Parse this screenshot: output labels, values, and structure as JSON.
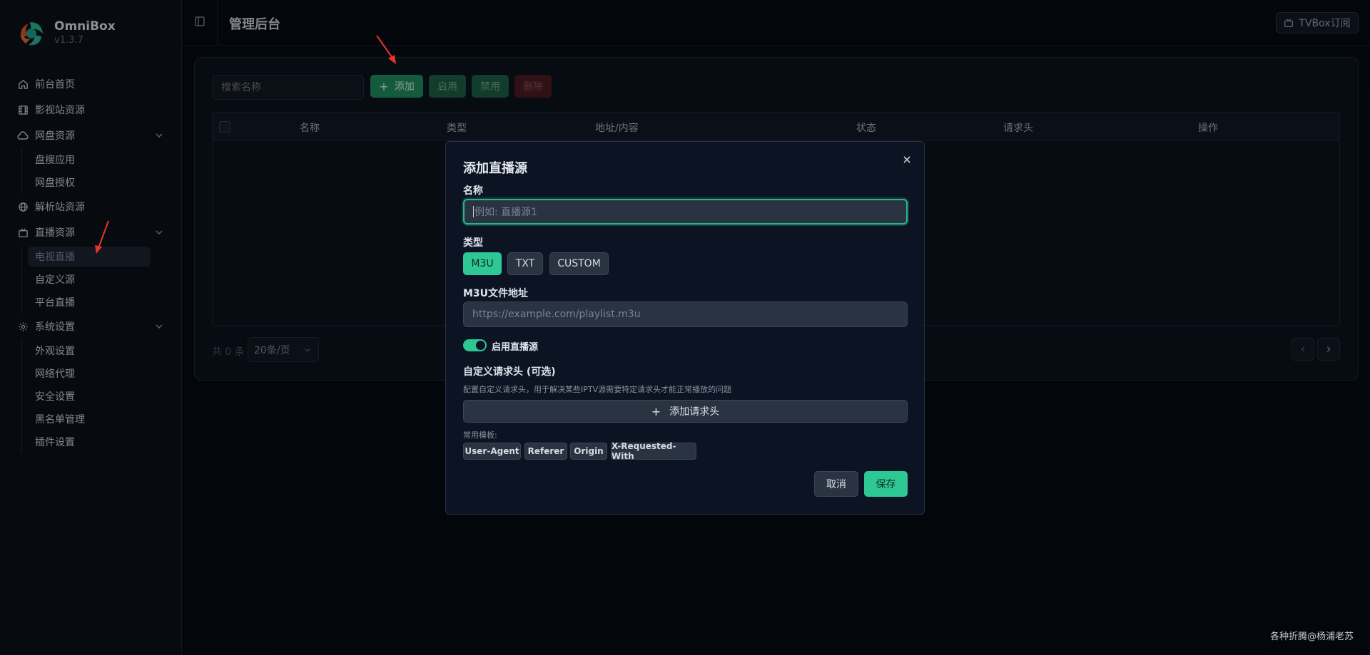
{
  "brand": {
    "name": "OmniBox",
    "version": "v1.3.7"
  },
  "nav": {
    "home": "前台首页",
    "video": "影视站资源",
    "cloud": "网盘资源",
    "cloud_sub": [
      "盘搜应用",
      "网盘授权"
    ],
    "parse": "解析站资源",
    "live": "直播资源",
    "live_sub": [
      "电视直播",
      "自定义源",
      "平台直播"
    ],
    "settings": "系统设置",
    "settings_sub": [
      "外观设置",
      "网络代理",
      "安全设置",
      "黑名单管理",
      "插件设置"
    ]
  },
  "header": {
    "title": "管理后台",
    "tvbox": "TVBox订阅"
  },
  "toolbar": {
    "search_placeholder": "搜索名称",
    "add": "添加",
    "enable": "启用",
    "disable": "禁用",
    "delete": "删除"
  },
  "table": {
    "columns": [
      "名称",
      "类型",
      "地址/内容",
      "状态",
      "请求头",
      "操作"
    ]
  },
  "pagination": {
    "total": "共 0 条",
    "page_size": "20条/页"
  },
  "modal": {
    "title": "添加直播源",
    "name_label": "名称",
    "name_placeholder": "例如: 直播源1",
    "type_label": "类型",
    "types": [
      "M3U",
      "TXT",
      "CUSTOM"
    ],
    "selected_type": "M3U",
    "url_label": "M3U文件地址",
    "url_placeholder": "https://example.com/playlist.m3u",
    "enable_label": "启用直播源",
    "enabled": true,
    "headers_label": "自定义请求头 (可选)",
    "headers_hint": "配置自定义请求头，用于解决某些IPTV源需要特定请求头才能正常播放的问题",
    "add_header": "添加请求头",
    "templates_label": "常用模板:",
    "templates": [
      "User-Agent",
      "Referer",
      "Origin",
      "X-Requested-With"
    ],
    "cancel": "取消",
    "save": "保存"
  },
  "watermark": "各种折腾@杨浦老苏",
  "colors": {
    "accent": "#2ec895",
    "background": "#060a12",
    "danger": "#4b1d22"
  }
}
